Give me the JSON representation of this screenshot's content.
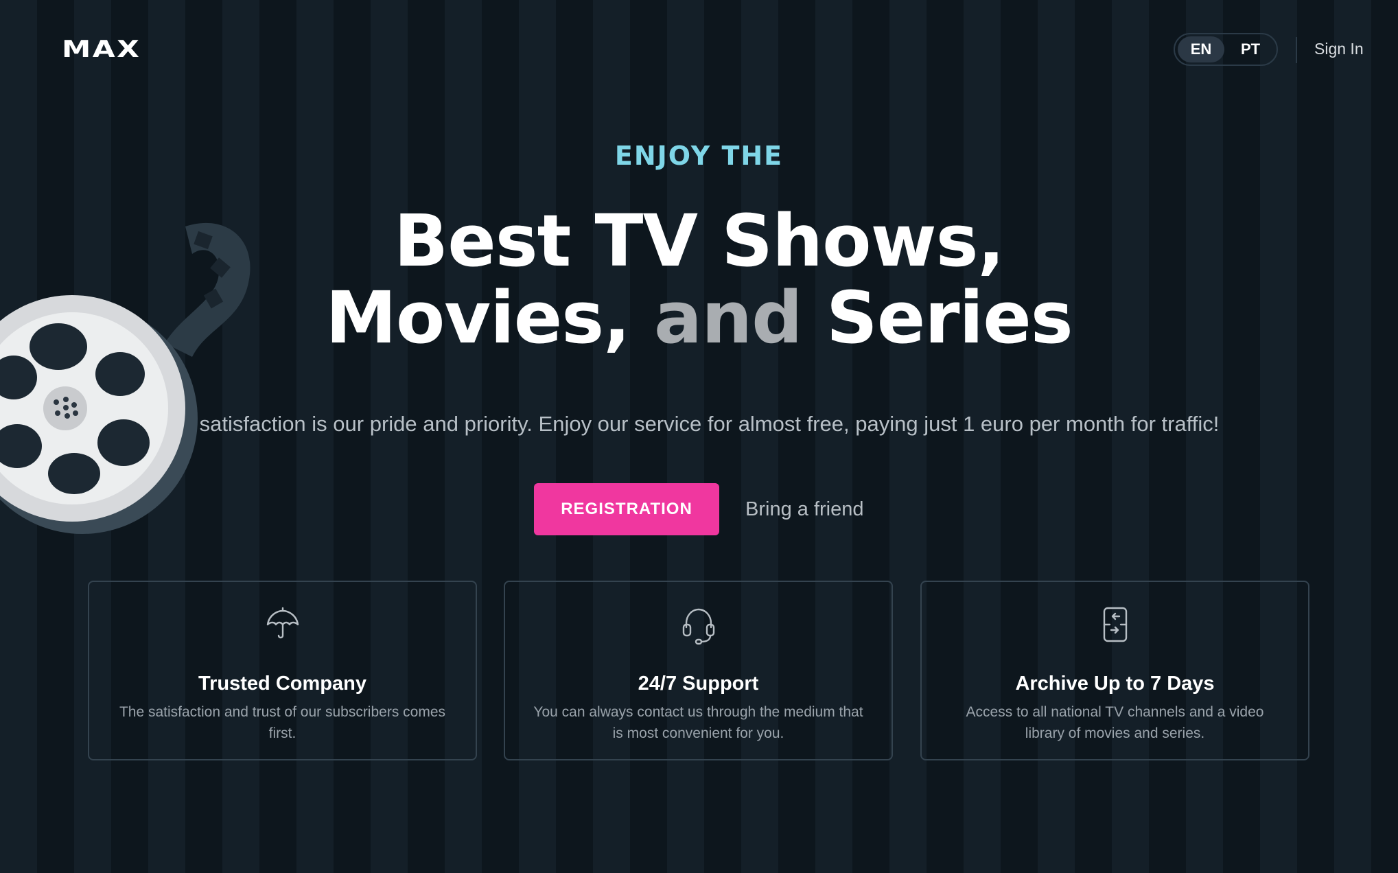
{
  "header": {
    "logo": "MAX",
    "languages": [
      {
        "code": "EN",
        "active": true
      },
      {
        "code": "PT",
        "active": false
      }
    ],
    "signin": "Sign In"
  },
  "hero": {
    "eyebrow": "ENJOY THE",
    "headline_line1": "Best TV Shows,",
    "headline_line2_a": "Movies,",
    "headline_line2_b": "and",
    "headline_line2_c": "Series",
    "subtitle": "satisfaction is our pride and priority. Enjoy our service for almost free, paying just 1 euro per month for traffic!",
    "registration_label": "REGISTRATION",
    "friend_label": "Bring a friend"
  },
  "features": [
    {
      "icon": "umbrella-icon",
      "title": "Trusted Company",
      "desc": "The satisfaction and trust of our subscribers comes first."
    },
    {
      "icon": "headset-icon",
      "title": "24/7 Support",
      "desc": "You can always contact us through the medium that is most convenient for you."
    },
    {
      "icon": "archive-icon",
      "title": "Archive Up to 7 Days",
      "desc": "Access to all national TV channels and a video library of movies and series."
    }
  ],
  "colors": {
    "accent": "#f0379f",
    "eyebrow": "#7fd6e8",
    "background": "#0f1820"
  }
}
